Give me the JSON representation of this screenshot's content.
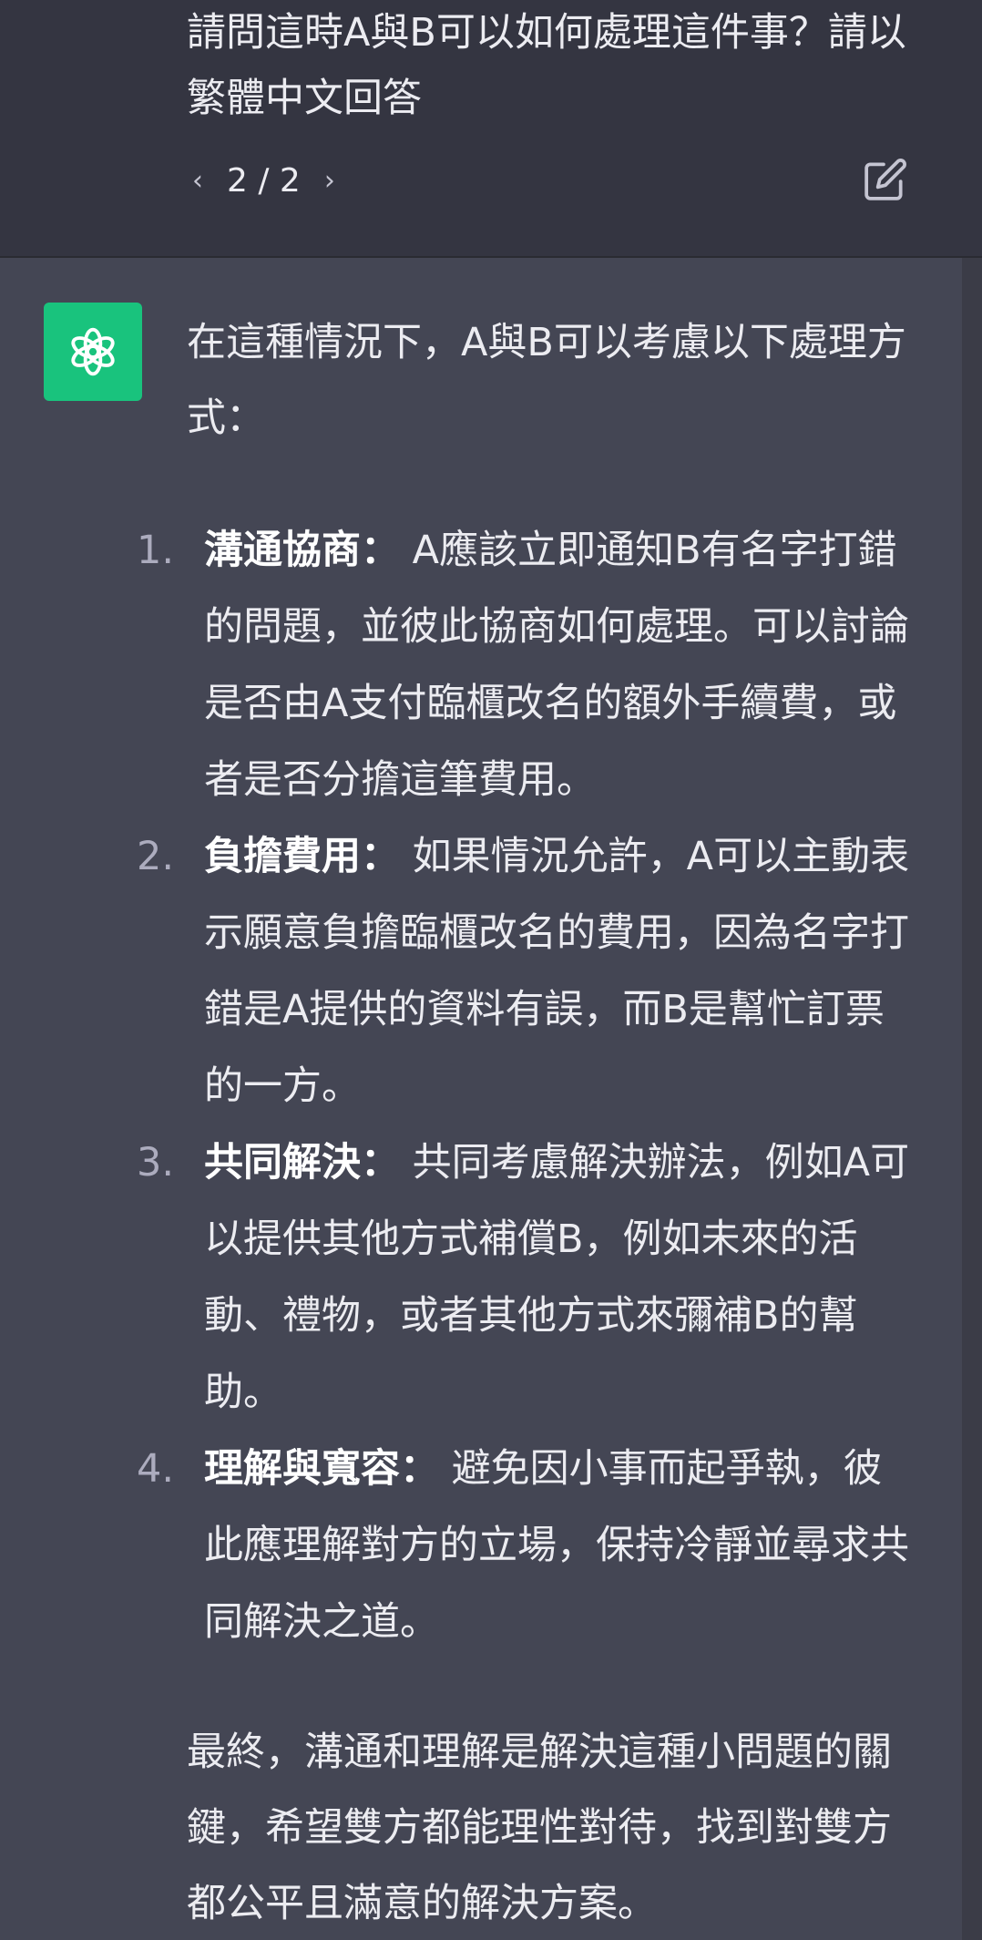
{
  "user_message": {
    "text": "請問這時A與B可以如何處理這件事？請以繁體中文回答",
    "pager": "2 / 2"
  },
  "assistant_message": {
    "intro": "在這種情況下，A與B可以考慮以下處理方式：",
    "items": [
      {
        "number": "1.",
        "term": "溝通協商：",
        "text": " A應該立即通知B有名字打錯的問題，並彼此協商如何處理。可以討論是否由A支付臨櫃改名的額外手續費，或者是否分擔這筆費用。"
      },
      {
        "number": "2.",
        "term": "負擔費用：",
        "text": " 如果情況允許，A可以主動表示願意負擔臨櫃改名的費用，因為名字打錯是A提供的資料有誤，而B是幫忙訂票的一方。"
      },
      {
        "number": "3.",
        "term": "共同解決：",
        "text": " 共同考慮解決辦法，例如A可以提供其他方式補償B，例如未來的活動、禮物，或者其他方式來彌補B的幫助。"
      },
      {
        "number": "4.",
        "term": "理解與寬容：",
        "text": " 避免因小事而起爭執，彼此應理解對方的立場，保持冷靜並尋求共同解決之道。"
      }
    ],
    "conclusion": "最終，溝通和理解是解決這種小問題的關鍵，希望雙方都能理性對待，找到對雙方都公平且滿意的解決方案。"
  },
  "colors": {
    "user_bg": "#343541",
    "assistant_bg": "#444654",
    "avatar_bg": "#19c37d",
    "text": "#ececf1"
  },
  "icons": {
    "prev": "chevron-left-icon",
    "next": "chevron-right-icon",
    "edit": "edit-icon",
    "avatar": "openai-logo-icon"
  }
}
